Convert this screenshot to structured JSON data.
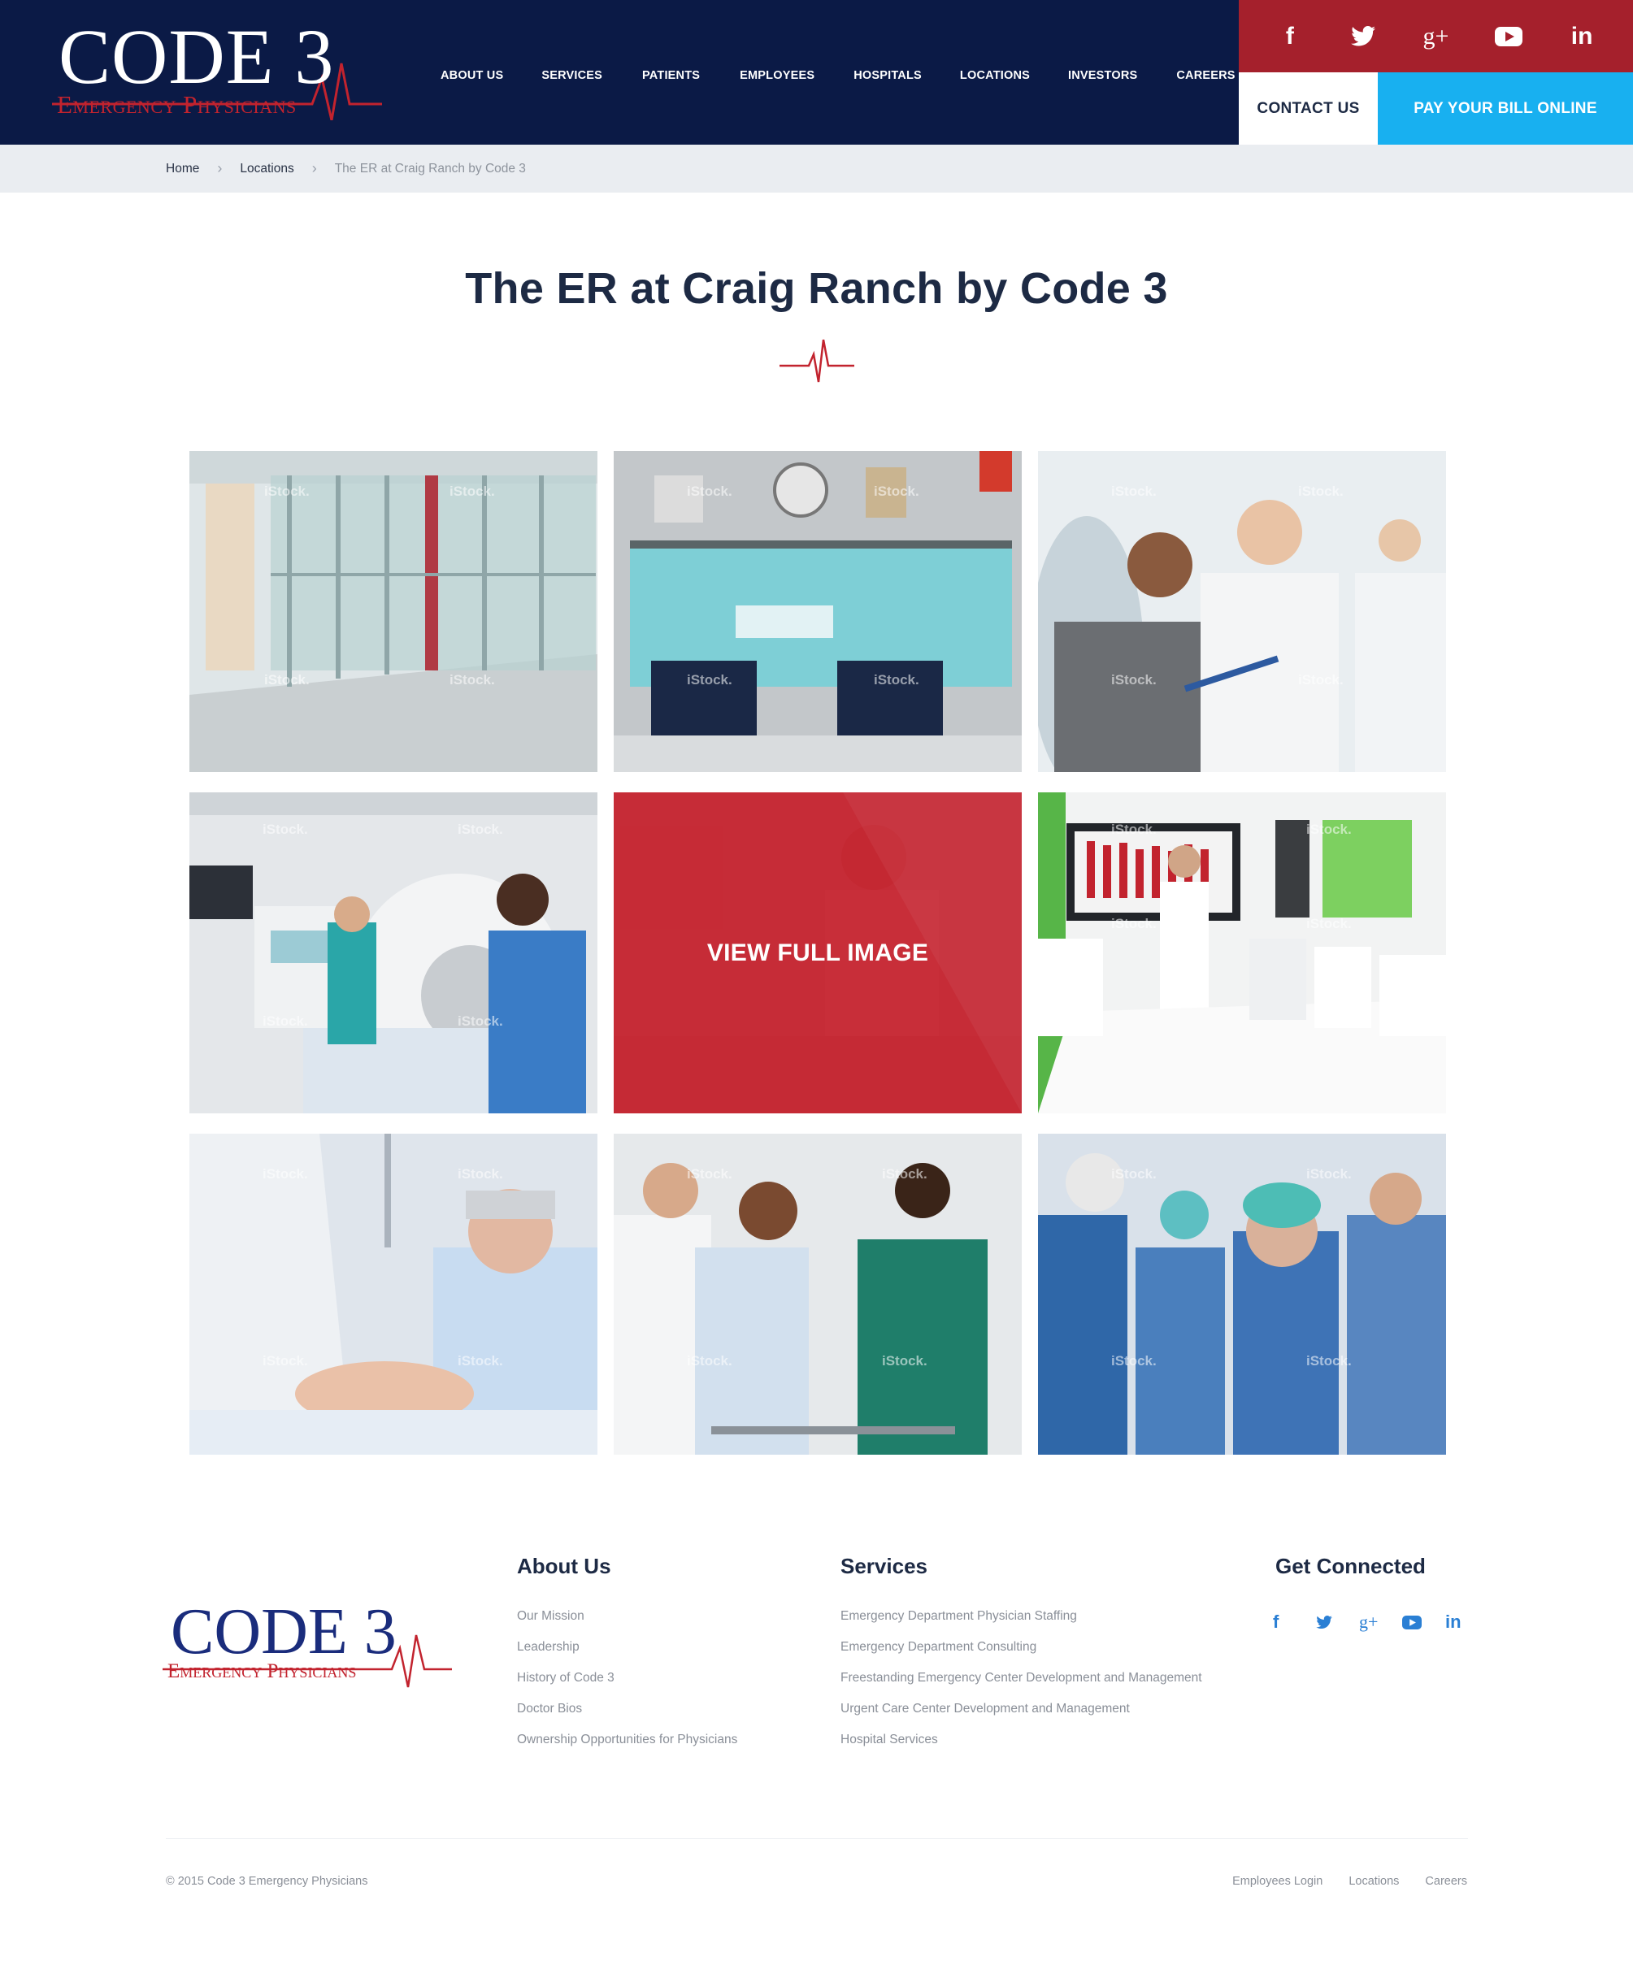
{
  "brand": {
    "name_line1": "CODE 3",
    "name_line2": "Emergency Physicians",
    "colors": {
      "navy": "#0b1a46",
      "red": "#a5202c",
      "sky": "#18b0f0",
      "logo_blue": "#1a2c7c"
    }
  },
  "nav": {
    "items": [
      "ABOUT US",
      "SERVICES",
      "PATIENTS",
      "EMPLOYEES",
      "HOSPITALS",
      "LOCATIONS",
      "INVESTORS",
      "CAREERS"
    ]
  },
  "social": {
    "icons": [
      "facebook-icon",
      "twitter-icon",
      "google-plus-icon",
      "youtube-icon",
      "linkedin-icon"
    ],
    "glyphs": [
      "f",
      "t",
      "g+",
      "▶",
      "in"
    ]
  },
  "header_actions": {
    "contact_label": "CONTACT US",
    "pay_label": "PAY YOUR BILL ONLINE"
  },
  "breadcrumb": {
    "home": "Home",
    "locations": "Locations",
    "current": "The ER at Craig Ranch by Code 3",
    "separator": "›"
  },
  "page": {
    "title": "The ER at Craig Ranch by Code 3"
  },
  "gallery": {
    "watermark": "iStock.",
    "overlay_label": "VIEW FULL IMAGE",
    "tiles": [
      "hallway",
      "operating-room",
      "doctors-meeting",
      "ct-scanner",
      "featured",
      "conference-room",
      "patient-bed",
      "physical-therapy",
      "surgical-team"
    ]
  },
  "footer": {
    "about": {
      "heading": "About Us",
      "links": [
        "Our Mission",
        "Leadership",
        "History of Code 3",
        "Doctor Bios",
        "Ownership Opportunities for Physicians"
      ]
    },
    "services": {
      "heading": "Services",
      "links": [
        "Emergency Department Physician Staffing",
        "Emergency Department Consulting",
        "Freestanding Emergency Center Development and Management",
        "Urgent Care Center Development and Management",
        "Hospital Services"
      ]
    },
    "connected": {
      "heading": "Get Connected"
    },
    "copyright": "© 2015 Code 3 Emergency Physicians",
    "bottom_links": [
      "Employees Login",
      "Locations",
      "Careers"
    ]
  }
}
